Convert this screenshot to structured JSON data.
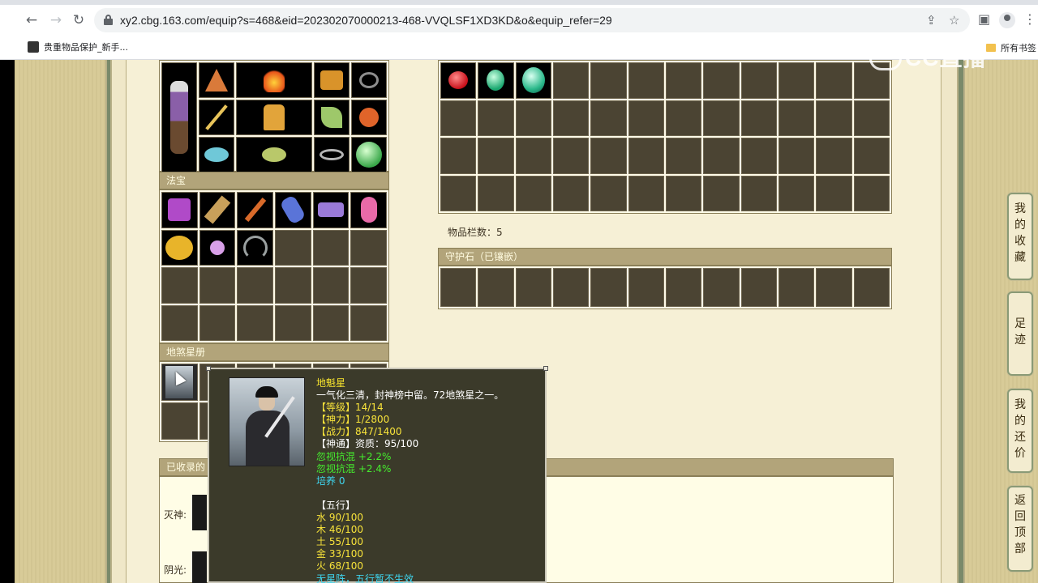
{
  "browser": {
    "url": "xy2.cbg.163.com/equip?s=468&eid=202302070000213-468-VVQLSF1XD3KD&o&equip_refer=29",
    "bookmark_left": "贵重物品保护_新手...",
    "bookmark_right": "所有书签"
  },
  "watermark": "CC直播",
  "sections": {
    "fabao_title": "法宝",
    "disha_title": "地煞星册",
    "guardian_title": "守护石（已镶嵌）",
    "collected_title": "已收录的"
  },
  "inventory": {
    "count_label": "物品栏数：5"
  },
  "collected_rows": [
    "灭神:",
    "阴光:"
  ],
  "side_buttons": [
    {
      "label": "我的收藏",
      "chars": [
        "我",
        "的",
        "收",
        "藏"
      ]
    },
    {
      "label": "足迹",
      "chars": [
        "足",
        "迹"
      ]
    },
    {
      "label": "我的还价",
      "chars": [
        "我",
        "的",
        "还",
        "价"
      ]
    },
    {
      "label": "返回顶部",
      "chars": [
        "返",
        "回",
        "顶",
        "部"
      ]
    }
  ],
  "tooltip": {
    "name": "地魁星",
    "desc": "一气化三清，封神榜中留。72地煞星之一。",
    "level": "【等级】14/14",
    "divinity": "【神力】1/2800",
    "combat": "【战力】847/1400",
    "shentong": "【神通】资质：95/100",
    "attr1": "忽视抗混 +2.2%",
    "attr2": "忽视抗混 +2.4%",
    "cultivate": "培养 0",
    "wuxing_title": "【五行】",
    "water": "水 90/100",
    "wood": "木 46/100",
    "earth": "土 55/100",
    "metal": "金 33/100",
    "fire": "火 68/100",
    "formation": "无星阵，五行暂不生效"
  },
  "colors": {
    "panel_head": "#b2a47a",
    "cell": "#4b4433",
    "tooltip_bg": "#3b3a2a",
    "tip_yellow": "#f7e42e",
    "tip_green": "#45ee2e",
    "tip_cyan": "#3ed6f0"
  }
}
